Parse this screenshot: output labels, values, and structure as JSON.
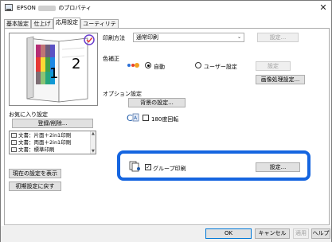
{
  "window": {
    "title_prefix": "EPSON",
    "title_suffix": "のプロパティ",
    "close_glyph": "✕"
  },
  "tabs": [
    {
      "label": "基本設定"
    },
    {
      "label": "仕上げ"
    },
    {
      "label": "応用設定"
    },
    {
      "label": "ユーティリティー"
    }
  ],
  "print_method": {
    "label": "印刷方法",
    "value": "通常印刷",
    "settings_button": "設定..."
  },
  "color_correction": {
    "label": "色補正",
    "option_auto": "自動",
    "option_user": "ユーザー設定",
    "settings_button": "設定",
    "image_processing_button": "画像処理設定..."
  },
  "option_settings": {
    "label": "オプション設定",
    "background_button": "背景の設定...",
    "rotate_180_label": "180度回転"
  },
  "favorites": {
    "label": "お気に入り設定",
    "register_button": "登録/削除...",
    "items": [
      {
        "label": "文書：片面＋2in1印刷"
      },
      {
        "label": "文書：両面＋2in1印刷"
      },
      {
        "label": "文書：標準印刷"
      }
    ]
  },
  "preview": {
    "page_number_1": "1",
    "page_number_2": "2"
  },
  "group_print": {
    "label": "グループ印刷",
    "settings_button": "設定..."
  },
  "left_buttons": {
    "show_current": "現在の設定を表示",
    "reset_default": "初期設定に戻す"
  },
  "footer": {
    "ok": "OK",
    "cancel": "キャンセル",
    "apply": "適用",
    "help": "ヘルプ"
  },
  "colors": {
    "highlight": "#1565e0",
    "radio_dot_red": "#e5402a",
    "radio_dot_blue": "#2a6fd6"
  }
}
